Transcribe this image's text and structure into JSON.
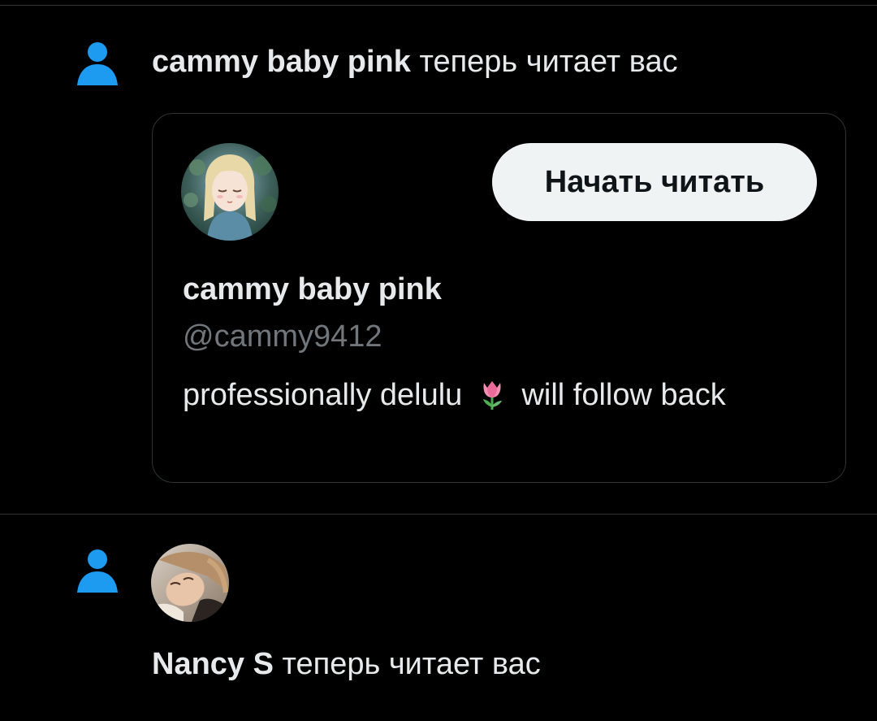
{
  "colors": {
    "background": "#000000",
    "accent_icon": "#1d9bf0",
    "text_primary": "#e7e9ea",
    "text_secondary": "#71767b",
    "button_bg": "#eff3f4",
    "button_text": "#0f1419",
    "border": "#2f3336"
  },
  "notifications": [
    {
      "icon": "person-icon",
      "user_name": "cammy baby pink",
      "action_text": "теперь читает вас",
      "card": {
        "avatar": "anime-girl-avatar",
        "follow_button_label": "Начать читать",
        "display_name": "cammy baby pink",
        "handle": "@cammy9412",
        "bio_before_emoji": "professionally delulu",
        "bio_emoji": "tulip-icon",
        "bio_after_emoji": "will follow back"
      }
    },
    {
      "icon": "person-icon",
      "avatar": "user-photo-avatar",
      "user_name": "Nancy S",
      "action_text": "теперь читает вас"
    }
  ]
}
